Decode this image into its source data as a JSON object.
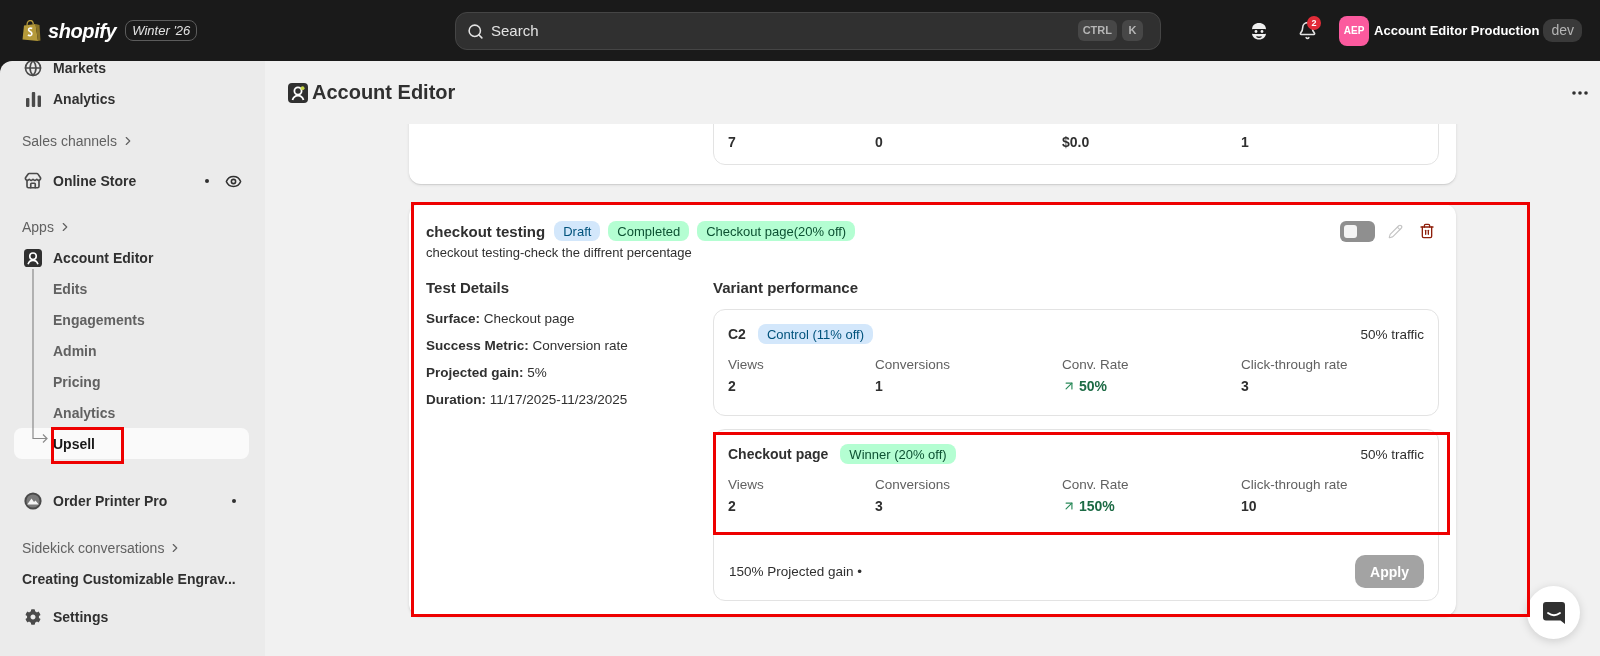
{
  "top_bar": {
    "logo_text": "shopify",
    "edition": "Winter '26",
    "search": {
      "placeholder": "Search",
      "shortcut": [
        "CTRL",
        "K"
      ]
    },
    "notifications": {
      "count": "2"
    },
    "store": {
      "initials": "AEP",
      "name": "Account Editor Production",
      "badge": "dev"
    }
  },
  "sidebar": {
    "items": [
      {
        "kind": "link",
        "label": "Markets",
        "selected": false,
        "dot": false,
        "preview": false
      },
      {
        "kind": "link",
        "label": "Analytics",
        "selected": false,
        "dot": false,
        "preview": false
      },
      {
        "kind": "header",
        "label": "Sales channels",
        "selected": false,
        "dot": false,
        "preview": false
      },
      {
        "kind": "link",
        "label": "Online Store",
        "selected": false,
        "dot": true,
        "preview": true
      },
      {
        "kind": "header",
        "label": "Apps",
        "selected": false,
        "dot": false,
        "preview": false
      },
      {
        "kind": "app",
        "label": "Account Editor",
        "selected": false,
        "dot": false,
        "preview": false,
        "children": [
          {
            "label": "Edits",
            "selected": false,
            "highlighted": false
          },
          {
            "label": "Engagements",
            "selected": false,
            "highlighted": false
          },
          {
            "label": "Admin",
            "selected": false,
            "highlighted": false
          },
          {
            "label": "Pricing",
            "selected": false,
            "highlighted": false
          },
          {
            "label": "Analytics",
            "selected": false,
            "highlighted": false
          },
          {
            "label": "Upsell",
            "selected": true,
            "highlighted": true
          }
        ]
      },
      {
        "kind": "link",
        "label": "Order Printer Pro",
        "selected": false,
        "dot": true,
        "preview": false
      },
      {
        "kind": "header",
        "label": "Sidekick conversations",
        "selected": false,
        "dot": false,
        "preview": false
      },
      {
        "kind": "thread",
        "label": "Creating Customizable Engrav...",
        "selected": false,
        "dot": false,
        "preview": false
      },
      {
        "kind": "link",
        "label": "Settings",
        "selected": false,
        "dot": false,
        "preview": false
      }
    ]
  },
  "page": {
    "title": "Account Editor"
  },
  "previous_test": {
    "metrics": [
      {
        "kind": "count",
        "value": "7"
      },
      {
        "kind": "count",
        "value": "0"
      },
      {
        "kind": "count",
        "value": "$0.0"
      },
      {
        "kind": "count",
        "value": "1"
      }
    ]
  },
  "test": {
    "title": "checkout testing",
    "badges": [
      {
        "kind": "info",
        "label": "Draft"
      },
      {
        "kind": "success",
        "label": "Completed"
      },
      {
        "kind": "success",
        "label": "Checkout page(20% off)"
      }
    ],
    "description": "checkout testing-check the diffrent percentage",
    "enabled": false,
    "edit_disabled": true,
    "highlighted": true,
    "details": {
      "title": "Test Details",
      "rows": [
        "**Surface:** Checkout page",
        "**Success Metric:** Conversion rate",
        "**Projected gain:** 5%",
        "**Duration:** 11/17/2025-11/23/2025"
      ]
    },
    "performance": {
      "title": "Variant performance",
      "variants": [
        {
          "name": "C2",
          "badge": {
            "kind": "info",
            "label": "Control (11% off)"
          },
          "traffic": "50% traffic",
          "highlighted": false,
          "metrics": [
            {
              "kind": "count",
              "label": "Views",
              "value": "2"
            },
            {
              "kind": "count",
              "label": "Conversions",
              "value": "1"
            },
            {
              "kind": "trend",
              "label": "Conv. Rate",
              "value": "50%"
            },
            {
              "kind": "count",
              "label": "Click-through rate",
              "value": "3"
            }
          ]
        },
        {
          "name": "Checkout page",
          "badge": {
            "kind": "success",
            "label": "Winner (20% off)"
          },
          "traffic": "50% traffic",
          "highlighted": true,
          "metrics": [
            {
              "kind": "count",
              "label": "Views",
              "value": "2"
            },
            {
              "kind": "count",
              "label": "Conversions",
              "value": "3"
            },
            {
              "kind": "trend",
              "label": "Conv. Rate",
              "value": "150%"
            },
            {
              "kind": "count",
              "label": "Click-through rate",
              "value": "10"
            }
          ]
        }
      ],
      "summary": "150% Projected gain •",
      "apply": {
        "label": "Apply",
        "disabled": true
      }
    }
  }
}
